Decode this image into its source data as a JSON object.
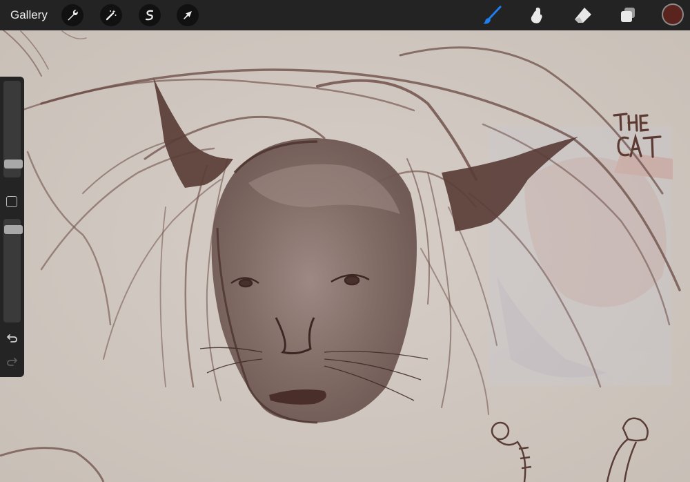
{
  "topbar": {
    "gallery_label": "Gallery",
    "left_tools": [
      {
        "name": "actions",
        "icon": "wrench-icon"
      },
      {
        "name": "adjustments",
        "icon": "magic-wand-icon"
      },
      {
        "name": "selection",
        "icon": "selection-s-icon"
      },
      {
        "name": "transform",
        "icon": "arrow-cursor-icon"
      }
    ],
    "right_tools": [
      {
        "name": "brush",
        "icon": "brush-icon",
        "active": true
      },
      {
        "name": "smudge",
        "icon": "smudge-finger-icon",
        "active": false
      },
      {
        "name": "eraser",
        "icon": "eraser-icon",
        "active": false
      },
      {
        "name": "layers",
        "icon": "layers-icon",
        "active": false
      }
    ],
    "current_color": "#5a231d",
    "active_tool_color": "#1e7ff0"
  },
  "sidebar": {
    "brush_size_level": 0.15,
    "opacity_level": 0.95,
    "modify_button_icon": "square-icon",
    "undo_icon": "undo-icon",
    "redo_icon": "redo-icon"
  },
  "canvas": {
    "sketch_label": "THE CAT",
    "paper_color": "#d2c9c2",
    "ink_color": "#5e3a32"
  }
}
